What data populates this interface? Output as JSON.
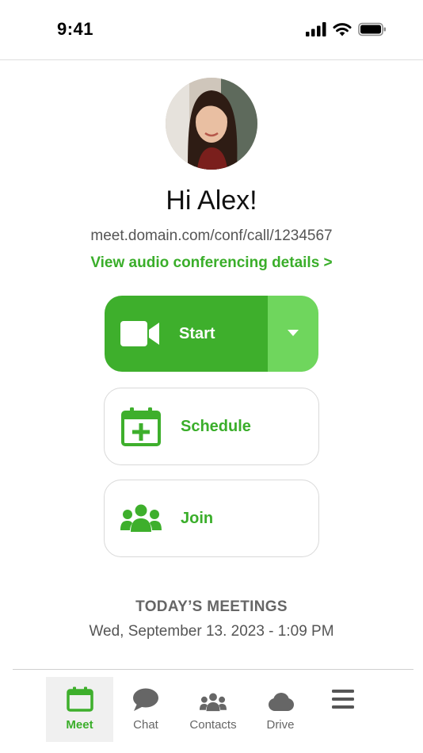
{
  "status_bar": {
    "time": "9:41"
  },
  "profile": {
    "greeting": "Hi Alex!",
    "conference_url": "meet.domain.com/conf/call/1234567",
    "audio_link": "View audio conferencing details >"
  },
  "actions": {
    "start_label": "Start",
    "schedule_label": "Schedule",
    "join_label": "Join"
  },
  "meetings": {
    "title": "TODAY’S MEETINGS",
    "date": "Wed, September 13. 2023 - 1:09 PM"
  },
  "tabs": [
    {
      "label": "Meet",
      "icon": "calendar-icon",
      "active": true
    },
    {
      "label": "Chat",
      "icon": "chat-bubble-icon"
    },
    {
      "label": "Contacts",
      "icon": "contacts-icon"
    },
    {
      "label": "Drive",
      "icon": "cloud-icon"
    },
    {
      "label": "",
      "icon": "hamburger-menu-icon"
    }
  ],
  "colors": {
    "accent": "#3eaf2c",
    "accent_light": "#6fd65d",
    "text_green": "#3aae2a",
    "muted_text": "#555555"
  }
}
